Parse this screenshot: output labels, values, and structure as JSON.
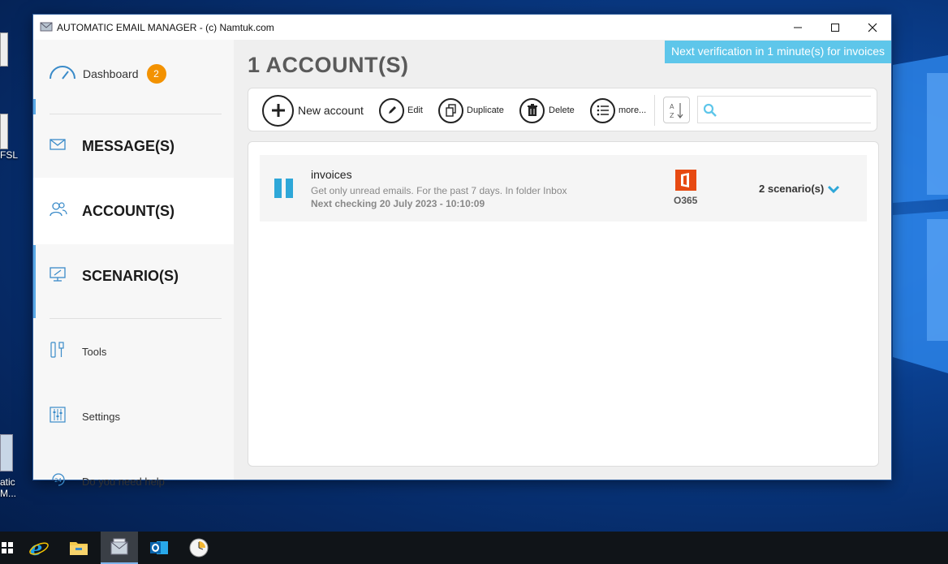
{
  "window": {
    "title": "AUTOMATIC EMAIL MANAGER - (c) Namtuk.com"
  },
  "desktop": {
    "icons": [
      {
        "label": "FSL"
      },
      {
        "label": "atic"
      },
      {
        "label": "M..."
      }
    ]
  },
  "sidebar": {
    "dashboard": {
      "label": "Dashboard",
      "badge": "2"
    },
    "items": [
      {
        "label": "MESSAGE(S)",
        "icon": "envelope-icon"
      },
      {
        "label": "ACCOUNT(S)",
        "icon": "users-icon"
      },
      {
        "label": "SCENARIO(S)",
        "icon": "monitor-icon"
      }
    ],
    "tools": {
      "label": "Tools",
      "icon": "tools-icon"
    },
    "settings": {
      "label": "Settings",
      "icon": "sliders-icon"
    },
    "help": {
      "label": "Do you need help",
      "icon": "support-24-icon"
    }
  },
  "main": {
    "title": "1 ACCOUNT(S)",
    "notice": "Next verification in 1 minute(s) for invoices",
    "toolbar": {
      "new": "New account",
      "edit": "Edit",
      "duplicate": "Duplicate",
      "delete": "Delete",
      "more": "more...",
      "sort_icon": "sort-az-icon",
      "search_placeholder": ""
    },
    "accounts": [
      {
        "name": "invoices",
        "description": "Get only unread emails. For the past 7 days. In folder Inbox",
        "next_check": "Next checking 20 July 2023 - 10:10:09",
        "provider": "O365",
        "scenarios": "2 scenario(s)",
        "status_icon": "pause-icon"
      }
    ]
  },
  "colors": {
    "accent": "#5aa9e6",
    "badge": "#f39200",
    "notice": "#5ec6ea",
    "office": "#e74a12"
  }
}
